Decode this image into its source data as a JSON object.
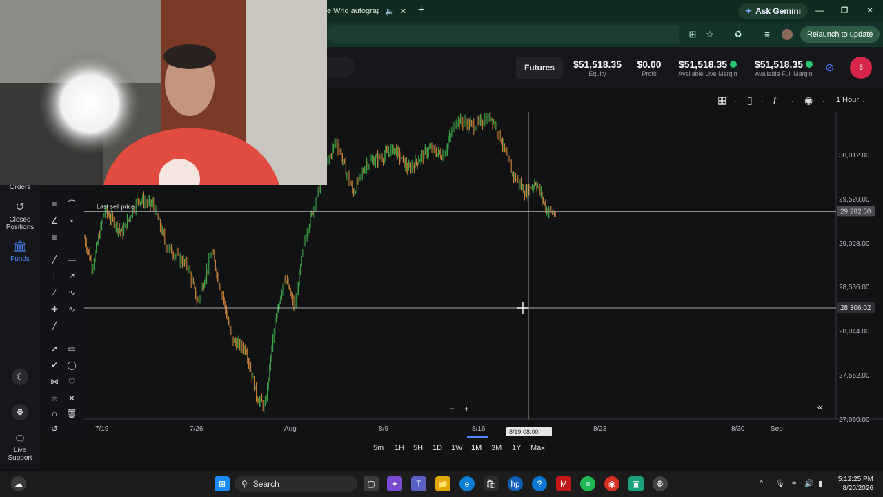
{
  "browser": {
    "tab_title": "e Wrld autograph",
    "gemini_label": "Ask Gemini",
    "relaunch_label": "Relaunch to update"
  },
  "header": {
    "futures_label": "Futures",
    "metrics": [
      {
        "value": "$51,518.35",
        "label": "Equity",
        "dot": false
      },
      {
        "value": "$0.00",
        "label": "Profit",
        "dot": false
      },
      {
        "value": "$51,518.35",
        "label": "Available Live Margin",
        "dot": true
      },
      {
        "value": "$51,518.35",
        "label": "Available Full Margin",
        "dot": true
      }
    ],
    "notification_count": "3"
  },
  "chart_toolbar": {
    "interval": "1 Hour"
  },
  "sidebar": {
    "items": [
      {
        "label": "Orders",
        "icon": "orders-icon"
      },
      {
        "label_line1": "Closed",
        "label_line2": "Positions",
        "icon": "history-icon"
      },
      {
        "label": "Funds",
        "icon": "bank-icon"
      }
    ],
    "support_line1": "Live",
    "support_line2": "Support"
  },
  "chart_data": {
    "type": "candlestick",
    "interval": "1 Hour",
    "x_labels": [
      "7/19",
      "7/26",
      "Aug",
      "8/9",
      "8/16",
      "8/23",
      "8/30",
      "Sep"
    ],
    "y_ticks": [
      "30,012.00",
      "29,520.00",
      "29,028.00",
      "28,536.00",
      "28,044.00",
      "27,552.00",
      "27,060.00"
    ],
    "y_range": [
      27060,
      30350
    ],
    "last_sell_price_label": "Last sell price",
    "last_sell_price": "29,282.50",
    "crosshair_price": "28,306.02",
    "crosshair_time": "8/19 08:00",
    "path": [
      [
        0,
        29000
      ],
      [
        12,
        28700
      ],
      [
        30,
        29300
      ],
      [
        55,
        29050
      ],
      [
        78,
        29420
      ],
      [
        100,
        29350
      ],
      [
        120,
        28900
      ],
      [
        150,
        28700
      ],
      [
        165,
        28300
      ],
      [
        185,
        28850
      ],
      [
        200,
        28400
      ],
      [
        215,
        27900
      ],
      [
        235,
        27800
      ],
      [
        250,
        27300
      ],
      [
        262,
        27180
      ],
      [
        275,
        28000
      ],
      [
        290,
        28600
      ],
      [
        305,
        28250
      ],
      [
        320,
        29000
      ],
      [
        345,
        29650
      ],
      [
        365,
        30050
      ],
      [
        390,
        29480
      ],
      [
        410,
        29800
      ],
      [
        430,
        29860
      ],
      [
        450,
        29960
      ],
      [
        470,
        29730
      ],
      [
        500,
        29950
      ],
      [
        520,
        29880
      ],
      [
        540,
        30260
      ],
      [
        565,
        30200
      ],
      [
        590,
        30300
      ],
      [
        600,
        30150
      ],
      [
        620,
        29700
      ],
      [
        640,
        29480
      ],
      [
        655,
        29600
      ],
      [
        670,
        29300
      ],
      [
        684,
        29250
      ]
    ]
  },
  "periods": [
    "5m",
    "1H",
    "5H",
    "1D",
    "1W",
    "1M",
    "3M",
    "1Y",
    "Max"
  ],
  "selected_period": "1M",
  "taskbar": {
    "search_label": "Search",
    "time": "5:12:25 PM",
    "date": "8/20/2026"
  }
}
